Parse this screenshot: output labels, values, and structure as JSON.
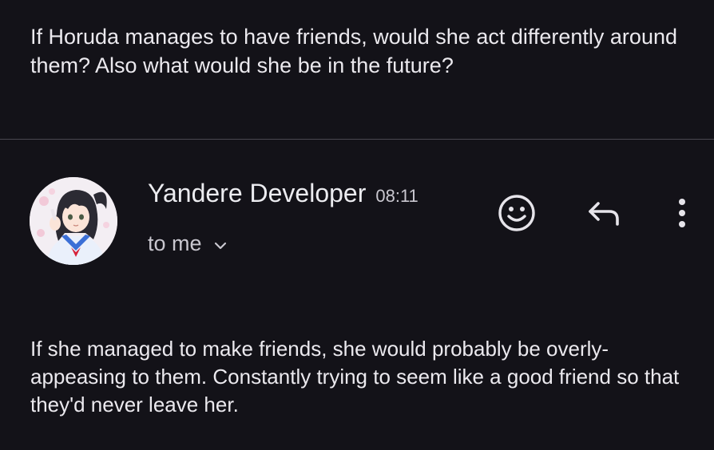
{
  "quoted_message": {
    "text": "If Horuda manages to have friends, would she act differently around them? Also what would she be in the future?"
  },
  "email": {
    "sender_name": "Yandere Developer",
    "time": "08:11",
    "recipient_label": "to me",
    "body": "If she managed to make friends, she would probably be overly-appeasing to them. Constantly trying to seem like a good friend so that they'd never leave her."
  },
  "icons": {
    "add_reaction": "smiley-icon",
    "reply": "reply-icon",
    "more": "more-vertical-icon",
    "expand_recipients": "chevron-down-icon"
  }
}
